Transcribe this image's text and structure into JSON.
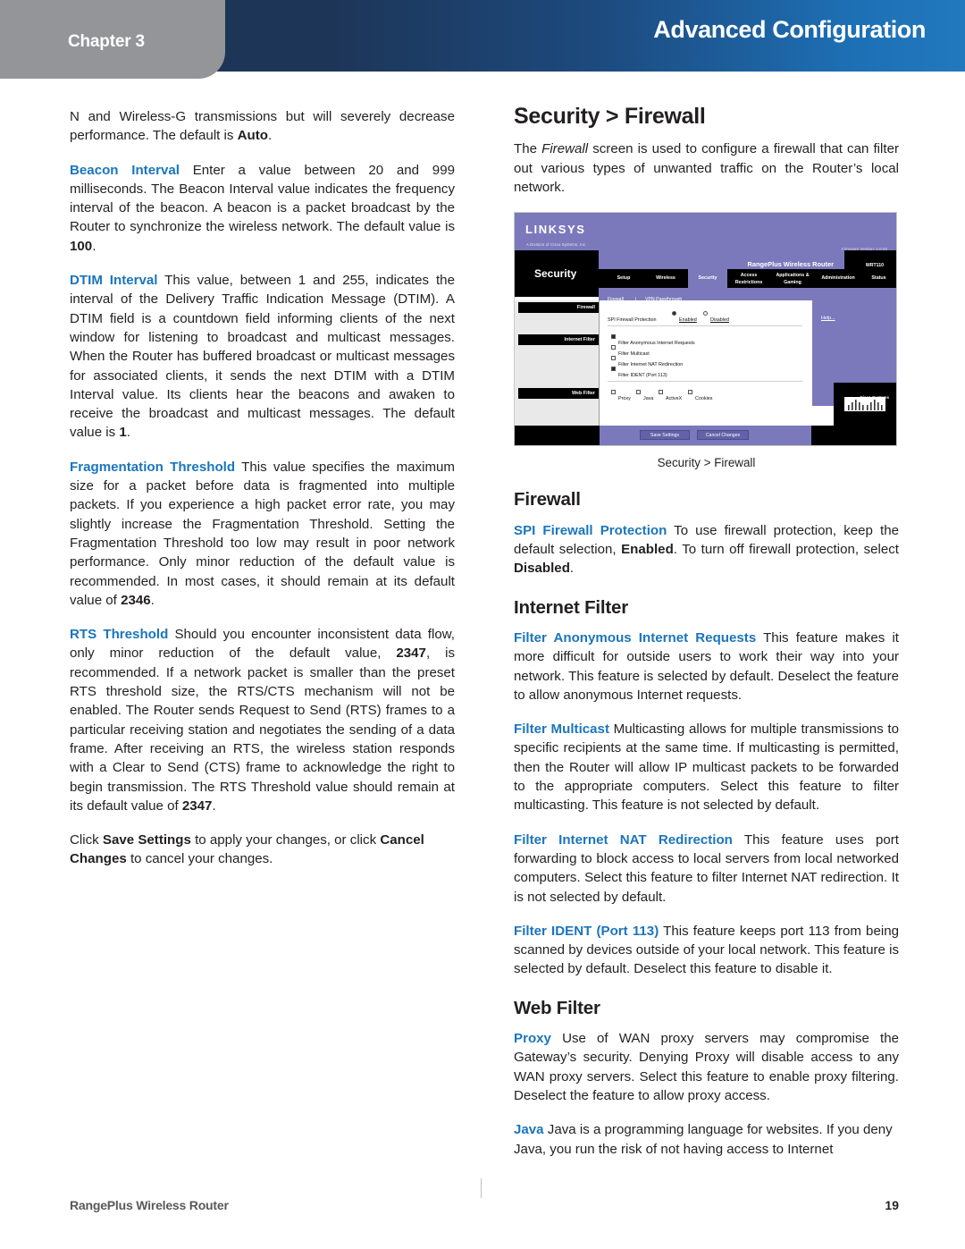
{
  "header": {
    "chapter_label": "Chapter 3",
    "title": "Advanced Configuration",
    "gradient_start": "#1d3557",
    "gradient_end": "#2279bd",
    "chapter_tab_color": "#939598"
  },
  "accent_color": "#1b75bc",
  "left_column": {
    "para_1": {
      "text_a": "N and Wireless-G transmissions but will severely decrease performance. The default is ",
      "bold_b": "Auto",
      "text_c": "."
    },
    "para_2": {
      "term": "Beacon Interval",
      "text_a": " Enter a value between 20 and 999 milliseconds. The Beacon Interval value indicates the frequency interval of the beacon. A beacon is a packet broadcast by the Router to synchronize the wireless network. The default value is ",
      "bold_b": "100",
      "text_c": "."
    },
    "para_3": {
      "term": "DTIM Interval",
      "text_a": " This value, between 1 and 255, indicates the interval of the Delivery Traffic Indication Message (DTIM). A DTIM field is a countdown field informing clients of the next window for listening to broadcast and multicast messages. When the Router has buffered broadcast or multicast messages for associated clients, it sends the next DTIM with a DTIM Interval value. Its clients hear the beacons and awaken to receive the broadcast and multicast messages. The default value is ",
      "bold_b": "1",
      "text_c": "."
    },
    "para_4": {
      "term": "Fragmentation Threshold",
      "text_a": " This value specifies the maximum size for a packet before data is fragmented into multiple packets. If you experience a high packet error rate, you may slightly increase the Fragmentation Threshold. Setting the Fragmentation Threshold too low may result in poor network performance. Only minor reduction of the default value is recommended. In most cases, it should remain at its default value of ",
      "bold_b": "2346",
      "text_c": "."
    },
    "para_5": {
      "term": "RTS Threshold",
      "text_a": "  Should you encounter inconsistent data flow, only minor reduction of the default value, ",
      "bold_b": "2347",
      "text_c": ", is recommended. If a network packet is smaller than the preset RTS threshold size, the RTS/CTS mechanism will not be enabled. The Router sends Request to Send (RTS) frames to a particular receiving station and negotiates the sending of a data frame. After receiving an RTS, the wireless station responds with a Clear to Send (CTS) frame to acknowledge the right to begin transmission. The RTS Threshold value should remain at its default value of ",
      "bold_d": "2347",
      "text_e": "."
    },
    "para_6": {
      "text_a": "Click ",
      "bold_b": "Save Settings",
      "text_c": " to apply your changes, or click ",
      "bold_d": "Cancel Changes",
      "text_e": " to cancel your changes."
    }
  },
  "right_column": {
    "section_title": "Security > Firewall",
    "intro": {
      "text_a": "The ",
      "italic_b": "Firewall",
      "text_c": " screen is used to configure a firewall that can filter out various types of unwanted traffic on the Router’s local network."
    },
    "figure_caption": "Security > Firewall",
    "subsection_firewall": "Firewall",
    "para_spi": {
      "term": "SPI Firewall Protection",
      "text_a": " To use firewall protection, keep the default selection, ",
      "bold_b": "Enabled",
      "text_c": ". To turn off firewall protection, select ",
      "bold_d": "Disabled",
      "text_e": "."
    },
    "subsection_internet_filter": "Internet Filter",
    "para_anon": {
      "term": "Filter Anonymous Internet Requests",
      "text_a": " This feature makes it more difficult for outside users to work their way into your network. This feature is selected by default. Deselect the feature to allow anonymous Internet requests."
    },
    "para_multicast": {
      "term": "Filter Multicast",
      "text_a": " Multicasting allows for multiple transmissions to specific recipients at the same time. If multicasting is permitted, then the Router will allow IP multicast packets to be forwarded to the appropriate computers. Select this feature to filter multicasting. This feature is not selected by default."
    },
    "para_nat": {
      "term": "Filter Internet NAT Redirection",
      "text_a": " This feature uses port forwarding to block access to local servers from local networked computers. Select this feature to filter Internet NAT redirection. It is not selected by default."
    },
    "para_ident": {
      "term": "Filter IDENT (Port 113)",
      "text_a": "  This feature keeps port 113 from being scanned by devices outside of your local network. This feature is selected by default. Deselect this feature to disable it."
    },
    "subsection_web_filter": "Web Filter",
    "para_proxy": {
      "term": "Proxy",
      "text_a": " Use of WAN proxy servers may compromise the Gateway’s security. Denying Proxy will disable access to any WAN proxy servers. Select this feature to enable proxy filtering. Deselect the feature to allow proxy access."
    },
    "para_java": {
      "term": "Java",
      "text_a": "  Java is a programming language for websites. If you deny Java, you run the risk of not having access to Internet"
    }
  },
  "router_screenshot": {
    "brand": "LINKSYS",
    "brand_sub": "A Division of Cisco Systems, Inc.",
    "firmware_version": "Firmware Version: 1.0.00",
    "product_name": "RangePlus Wireless Router",
    "model_number": "WRT110",
    "page_heading": "Security",
    "tabs": [
      "Setup",
      "Wireless",
      "Security",
      "Access Restrictions",
      "Applications & Gaming",
      "Administration",
      "Status"
    ],
    "active_tab": "Security",
    "subtabs": [
      "Firewall",
      "|",
      "VPN Passthrough"
    ],
    "active_subtab": "Firewall",
    "sidebar_sections": [
      "Firewall",
      "Internet Filter",
      "Web Filter"
    ],
    "spi_label": "SPI Firewall Protection",
    "spi_options": [
      {
        "label": "Enabled",
        "selected": true
      },
      {
        "label": "Disabled",
        "selected": false
      }
    ],
    "internet_filters": [
      {
        "label": "Filter Anonymous Internet Requests",
        "checked": true
      },
      {
        "label": "Filter Multicast",
        "checked": false
      },
      {
        "label": "Filter Internet NAT Redirection",
        "checked": false
      },
      {
        "label": "Filter IDENT (Port 113)",
        "checked": true
      }
    ],
    "web_filters": [
      {
        "label": "Proxy",
        "checked": false
      },
      {
        "label": "Java",
        "checked": false
      },
      {
        "label": "ActiveX",
        "checked": false
      },
      {
        "label": "Cookies",
        "checked": false
      }
    ],
    "help_link": "Help...",
    "buttons": [
      "Save Settings",
      "Cancel Changes"
    ],
    "cisco_logo_text": "Cisco Systems",
    "panel_color": "#7b79bb"
  },
  "footer": {
    "product": "RangePlus Wireless Router",
    "page_number": "19"
  }
}
